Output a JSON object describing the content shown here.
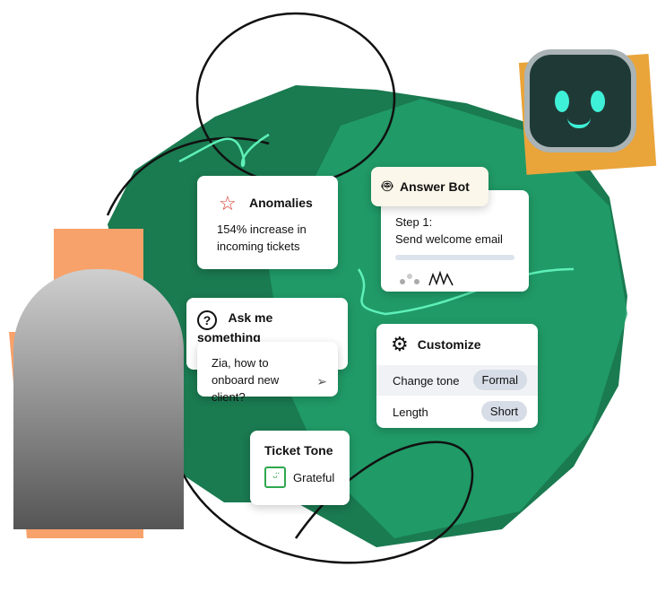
{
  "anomalies": {
    "title": "Anomalies",
    "text": "154% increase in incoming tickets",
    "icon": "star-icon",
    "accent": "#d63b2f"
  },
  "answer_bot": {
    "title": "Answer Bot",
    "step": "Step 1:",
    "step_text": "Send welcome email",
    "icon": "robot-icon"
  },
  "ask": {
    "title": "Ask me something",
    "input_value": "Zia, how to onboard new client?",
    "icon": "question-bubble-icon"
  },
  "customize": {
    "title": "Customize",
    "rows": [
      {
        "label": "Change tone",
        "value": "Formal"
      },
      {
        "label": "Length",
        "value": "Short"
      }
    ],
    "icon": "gear-icon"
  },
  "ticket_tone": {
    "title": "Ticket Tone",
    "value": "Grateful",
    "icon": "smiley-icon",
    "accent": "#2fa84f"
  },
  "colors": {
    "green": "#1f8a5c",
    "dark_green": "#156b45",
    "orange": "#f7a26b",
    "mint": "#5ef0b8"
  }
}
